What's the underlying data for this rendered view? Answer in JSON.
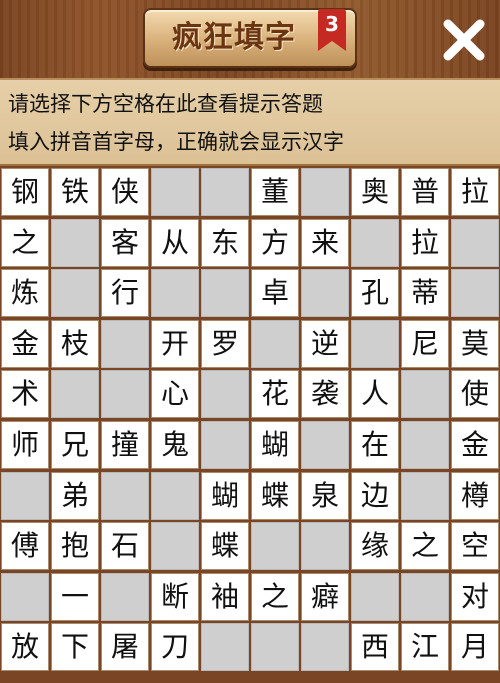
{
  "header": {
    "title": "疯狂填字",
    "level": "3",
    "close_icon": "close-icon"
  },
  "hint": {
    "line1": "请选择下方空格在此查看提示答题",
    "line2": "填入拼音首字母，正确就会显示汉字"
  },
  "grid": [
    [
      "钢",
      "铁",
      "侠",
      "",
      "",
      "董",
      "",
      "奥",
      "普",
      "拉"
    ],
    [
      "之",
      "",
      "客",
      "从",
      "东",
      "方",
      "来",
      "",
      "拉",
      ""
    ],
    [
      "炼",
      "",
      "行",
      "",
      "",
      "卓",
      "",
      "孔",
      "蒂",
      ""
    ],
    [
      "金",
      "枝",
      "",
      "开",
      "罗",
      "",
      "逆",
      "",
      "尼",
      "莫"
    ],
    [
      "术",
      "",
      "",
      "心",
      "",
      "花",
      "袭",
      "人",
      "",
      "使"
    ],
    [
      "师",
      "兄",
      "撞",
      "鬼",
      "",
      "蝴",
      "",
      "在",
      "",
      "金"
    ],
    [
      "",
      "弟",
      "",
      "",
      "蝴",
      "蝶",
      "泉",
      "边",
      "",
      "樽"
    ],
    [
      "傅",
      "抱",
      "石",
      "",
      "蝶",
      "",
      "",
      "缘",
      "之",
      "空"
    ],
    [
      "",
      "一",
      "",
      "断",
      "袖",
      "之",
      "癖",
      "",
      "",
      "对"
    ],
    [
      "放",
      "下",
      "屠",
      "刀",
      "",
      "",
      "",
      "西",
      "江",
      "月"
    ]
  ],
  "blocked": [
    [
      0,
      0,
      0,
      1,
      1,
      0,
      1,
      0,
      0,
      0
    ],
    [
      0,
      1,
      0,
      0,
      0,
      0,
      0,
      1,
      0,
      1
    ],
    [
      0,
      1,
      0,
      1,
      1,
      0,
      1,
      0,
      0,
      1
    ],
    [
      0,
      0,
      1,
      0,
      0,
      1,
      0,
      1,
      0,
      0
    ],
    [
      0,
      1,
      1,
      0,
      1,
      0,
      0,
      0,
      1,
      0
    ],
    [
      0,
      0,
      0,
      0,
      1,
      0,
      1,
      0,
      1,
      0
    ],
    [
      1,
      0,
      1,
      1,
      0,
      0,
      0,
      0,
      1,
      0
    ],
    [
      0,
      0,
      0,
      1,
      0,
      1,
      1,
      0,
      0,
      0
    ],
    [
      1,
      0,
      1,
      0,
      0,
      0,
      0,
      1,
      1,
      0
    ],
    [
      0,
      0,
      0,
      0,
      1,
      1,
      1,
      0,
      0,
      0
    ]
  ]
}
